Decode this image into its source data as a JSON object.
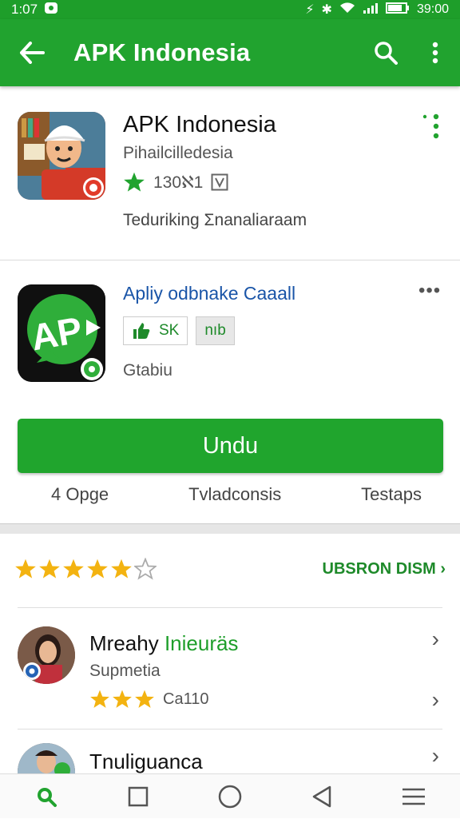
{
  "status_bar": {
    "time_left": "1:07",
    "time_right": "39:00"
  },
  "app_bar": {
    "title": "APK Indonesia",
    "back_icon": "arrow-left-icon",
    "search_icon": "search-icon",
    "menu_icon": "more-vert-icon"
  },
  "app1": {
    "name": "APK Indonesia",
    "developer": "Pihailcilledesia",
    "rating_text": "130ℵ1",
    "description": "Teduriking Ʃnanaliaraam"
  },
  "app2": {
    "name": "Apliy odbnake Caaall",
    "badge1": "SK",
    "badge2": "nıb",
    "status": "Gtabiu",
    "more": "•••"
  },
  "install_button": "Undu",
  "stats": [
    "4 Opge",
    "Tvladconsis",
    "Testaps"
  ],
  "ratings": {
    "stars_filled": 5,
    "stars_total": 6,
    "link": "UBSRON DISM"
  },
  "reviews": [
    {
      "name": "Mreahy",
      "name_green": "Inieuräs",
      "subtitle": "Supmetia",
      "stars": 3,
      "stars_label": "Ca110"
    },
    {
      "name": "Tnuliguanca"
    }
  ],
  "colors": {
    "accent": "#21a32f",
    "star": "#f3b311",
    "link_blue": "#1a55a8"
  }
}
